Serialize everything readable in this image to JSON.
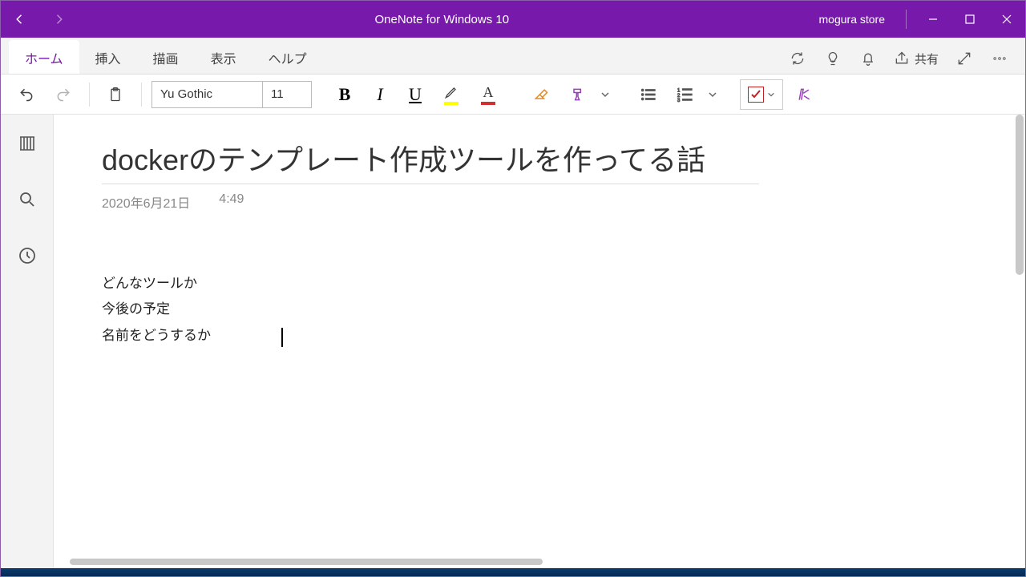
{
  "titlebar": {
    "app_title": "OneNote for Windows 10",
    "account": "mogura store"
  },
  "tabs": {
    "items": [
      "ホーム",
      "挿入",
      "描画",
      "表示",
      "ヘルプ"
    ],
    "share_label": "共有"
  },
  "ribbon": {
    "font_name": "Yu Gothic",
    "font_size": "11",
    "highlight_color": "#ffff00",
    "font_color": "#d03030"
  },
  "page": {
    "title": "dockerのテンプレート作成ツールを作ってる話",
    "date": "2020年6月21日",
    "time": "4:49",
    "lines": [
      "どんなツールか",
      "今後の予定",
      "名前をどうするか"
    ]
  }
}
